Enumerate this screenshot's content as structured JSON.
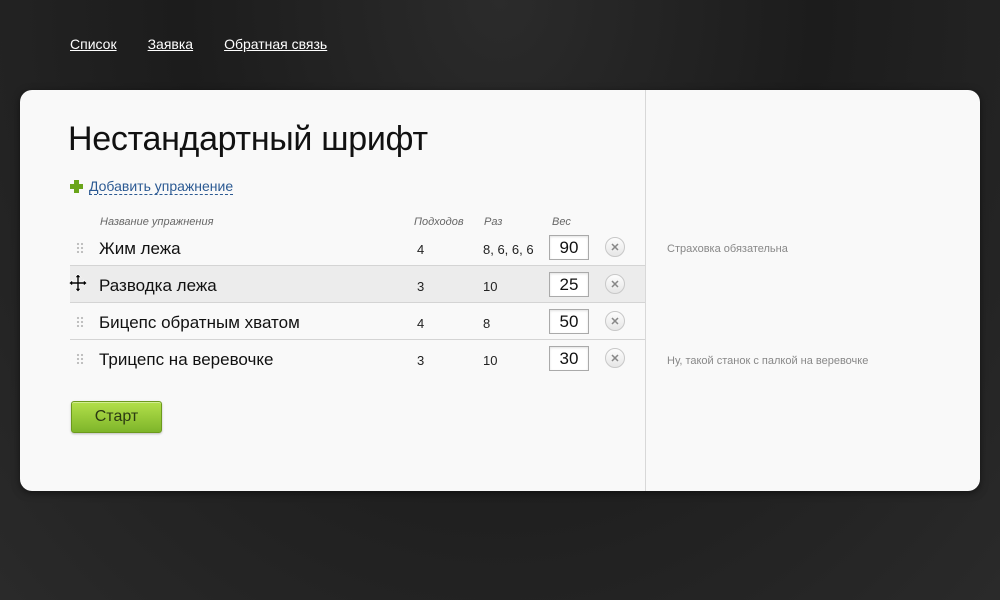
{
  "nav": {
    "items": [
      {
        "label": "Список"
      },
      {
        "label": "Заявка"
      },
      {
        "label": "Обратная связь"
      }
    ]
  },
  "page": {
    "title": "Нестандартный шрифт",
    "add_exercise_label": "Добавить упражнение",
    "start_label": "Старт"
  },
  "table": {
    "headers": {
      "name": "Название упражнения",
      "sets": "Подходов",
      "reps": "Раз",
      "weight": "Вес"
    },
    "rows": [
      {
        "name": "Жим лежа",
        "sets": "4",
        "reps": "8, 6, 6, 6",
        "weight": "90",
        "note": "Страховка обязательна"
      },
      {
        "name": "Разводка лежа",
        "sets": "3",
        "reps": "10",
        "weight": "25",
        "note": ""
      },
      {
        "name": "Бицепс обратным хватом",
        "sets": "4",
        "reps": "8",
        "weight": "50",
        "note": ""
      },
      {
        "name": "Трицепс на веревочке",
        "sets": "3",
        "reps": "10",
        "weight": "30",
        "note": "Ну, такой станок с палкой на веревочке"
      }
    ]
  },
  "colors": {
    "accent_green": "#7eb52a",
    "link_blue": "#2c5a93",
    "plus_green": "#6aa51a"
  },
  "icons": {
    "add": "plus-icon",
    "remove": "close-icon",
    "drag": "drag-handle-icon",
    "move_cursor": "move-cursor-icon"
  }
}
